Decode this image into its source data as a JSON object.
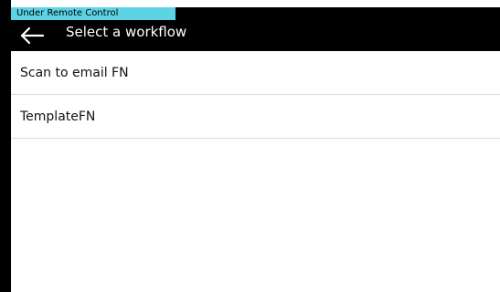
{
  "status": {
    "remote_control_label": "Under Remote Control"
  },
  "header": {
    "back_icon": "arrow-left-icon",
    "title": "Select a workflow"
  },
  "workflows": [
    {
      "label": "Scan to email FN"
    },
    {
      "label": "TemplateFN"
    }
  ],
  "colors": {
    "header_bg": "#000000",
    "badge_bg": "#5bd3e3",
    "divider": "#d9d9d9"
  }
}
